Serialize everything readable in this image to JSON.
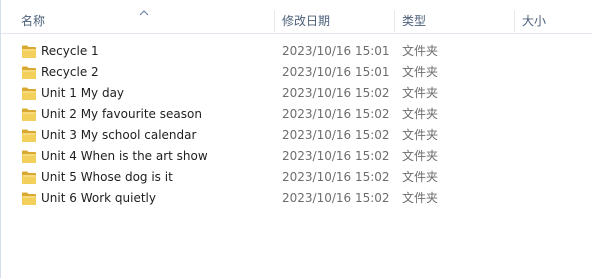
{
  "columns": {
    "name": "名称",
    "date": "修改日期",
    "type": "类型",
    "size": "大小"
  },
  "rows": [
    {
      "name": "Recycle 1",
      "date": "2023/10/16 15:01",
      "type": "文件夹",
      "size": ""
    },
    {
      "name": "Recycle 2",
      "date": "2023/10/16 15:01",
      "type": "文件夹",
      "size": ""
    },
    {
      "name": "Unit 1 My day",
      "date": "2023/10/16 15:02",
      "type": "文件夹",
      "size": ""
    },
    {
      "name": "Unit 2 My favourite season",
      "date": "2023/10/16 15:02",
      "type": "文件夹",
      "size": ""
    },
    {
      "name": "Unit 3 My school calendar",
      "date": "2023/10/16 15:02",
      "type": "文件夹",
      "size": ""
    },
    {
      "name": "Unit 4 When is the art show",
      "date": "2023/10/16 15:02",
      "type": "文件夹",
      "size": ""
    },
    {
      "name": "Unit 5 Whose dog is it",
      "date": "2023/10/16 15:02",
      "type": "文件夹",
      "size": ""
    },
    {
      "name": "Unit 6 Work quietly",
      "date": "2023/10/16 15:02",
      "type": "文件夹",
      "size": ""
    }
  ],
  "sort": {
    "column": "name",
    "direction": "ascending",
    "indicator": "sort-up-arrow-icon"
  },
  "icons": {
    "row": "folder-icon"
  },
  "colors": {
    "header_text": "#4c607a",
    "secondary_text": "#6d6d6d",
    "folder_yellow": "#f3cf5b",
    "folder_dark": "#d9a830"
  }
}
